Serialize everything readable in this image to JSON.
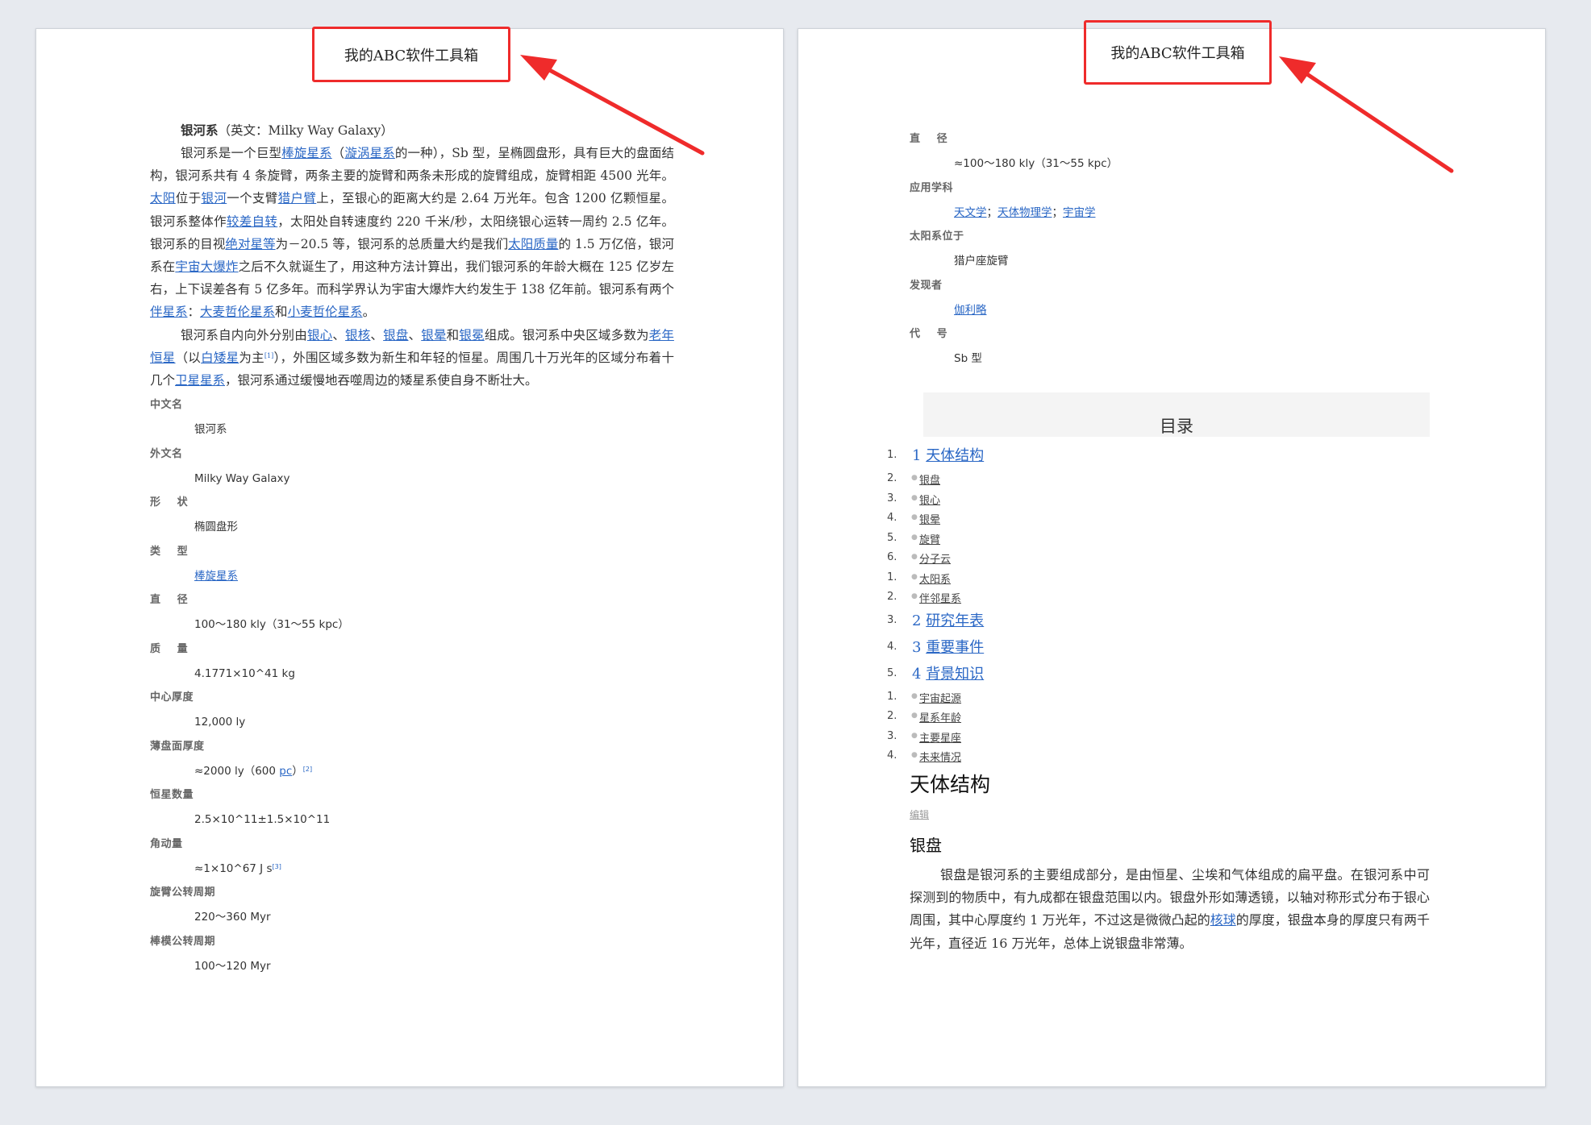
{
  "header_text": "我的ABC软件工具箱",
  "colors": {
    "annotation_red": "#ef2b2b",
    "link_blue": "#2a67c5"
  },
  "left": {
    "title_bold": "银河系",
    "title_rest": "（英文：Milky Way Galaxy）",
    "p1": [
      {
        "t": "银河系是一个巨型"
      },
      {
        "t": "棒旋星系",
        "link": true
      },
      {
        "t": "（"
      },
      {
        "t": "漩涡星系",
        "link": true
      },
      {
        "t": "的一种），Sb 型，呈椭圆盘形，具有巨大的盘面结构，银河系共有 4 条旋臂，两条主要的旋臂和两条未形成的旋臂组成，旋臂相距 4500 光年。"
      },
      {
        "t": "太阳",
        "link": true
      },
      {
        "t": "位于"
      },
      {
        "t": "银河",
        "link": true
      },
      {
        "t": "一个支臂"
      },
      {
        "t": "猎户臂",
        "link": true
      },
      {
        "t": "上，至银心的距离大约是 2.64 万光年。包含 1200 亿颗恒星。银河系整体作"
      },
      {
        "t": "较差自转",
        "link": true
      },
      {
        "t": "，太阳处自转速度约 220 千米/秒，太阳绕银心运转一周约 2.5 亿年。银河系的目视"
      },
      {
        "t": "绝对星等",
        "link": true
      },
      {
        "t": "为－20.5 等，银河系的总质量大约是我们"
      },
      {
        "t": "太阳质量",
        "link": true
      },
      {
        "t": "的 1.5 万亿倍，银河系在"
      },
      {
        "t": "宇宙大爆炸",
        "link": true
      },
      {
        "t": "之后不久就诞生了，用这种方法计算出，我们银河系的年龄大概在 125 亿岁左右，上下误差各有 5 亿多年。而科学界认为宇宙大爆炸大约发生于 138 亿年前。银河系有两个"
      },
      {
        "t": "伴星系",
        "link": true
      },
      {
        "t": "："
      },
      {
        "t": "大麦哲伦星系",
        "link": true
      },
      {
        "t": "和"
      },
      {
        "t": "小麦哲伦星系",
        "link": true
      },
      {
        "t": "。"
      }
    ],
    "p2": [
      {
        "t": "银河系自内向外分别由"
      },
      {
        "t": "银心",
        "link": true
      },
      {
        "t": "、"
      },
      {
        "t": "银核",
        "link": true
      },
      {
        "t": "、"
      },
      {
        "t": "银盘",
        "link": true
      },
      {
        "t": "、"
      },
      {
        "t": "银晕",
        "link": true
      },
      {
        "t": "和"
      },
      {
        "t": "银冕",
        "link": true
      },
      {
        "t": "组成。银河系中央区域多数为"
      },
      {
        "t": "老年恒星",
        "link": true
      },
      {
        "t": "（以"
      },
      {
        "t": "白矮星",
        "link": true
      },
      {
        "t": "为主"
      },
      {
        "t": "[1]",
        "sup": true
      },
      {
        "t": "），外围区域多数为新生和年轻的恒星。周围几十万光年的区域分布着十几个"
      },
      {
        "t": "卫星星系",
        "link": true
      },
      {
        "t": "，银河系通过缓慢地吞噬周边的矮星系使自身不断壮大。"
      }
    ],
    "infobox": [
      {
        "label": "中文名",
        "value": [
          {
            "t": "银河系"
          }
        ]
      },
      {
        "label": "外文名",
        "value": [
          {
            "t": "Milky Way Galaxy"
          }
        ]
      },
      {
        "label": "形    状",
        "value": [
          {
            "t": "椭圆盘形"
          }
        ]
      },
      {
        "label": "类    型",
        "value": [
          {
            "t": "棒旋星系",
            "link": true
          }
        ]
      },
      {
        "label": "直    径",
        "value": [
          {
            "t": "100～180 kly（31～55 kpc）"
          }
        ]
      },
      {
        "label": "质    量",
        "value": [
          {
            "t": "4.1771×10^41 kg"
          }
        ]
      },
      {
        "label": "中心厚度",
        "value": [
          {
            "t": "12,000 ly"
          }
        ]
      },
      {
        "label": "薄盘面厚度",
        "value": [
          {
            "t": "≈2000 ly（600 "
          },
          {
            "t": "pc",
            "link": true
          },
          {
            "t": "）"
          },
          {
            "t": "[2]",
            "sup": true
          }
        ]
      },
      {
        "label": "恒星数量",
        "value": [
          {
            "t": "2.5×10^11±1.5×10^11"
          }
        ]
      },
      {
        "label": "角动量",
        "value": [
          {
            "t": "≈1×10^67 J s"
          },
          {
            "t": "[3]",
            "sup": true
          }
        ]
      },
      {
        "label": "旋臂公转周期",
        "value": [
          {
            "t": "220～360 Myr"
          }
        ]
      },
      {
        "label": "棒模公转周期",
        "value": [
          {
            "t": "100～120 Myr"
          }
        ]
      }
    ]
  },
  "right": {
    "infobox": [
      {
        "label": "直    径",
        "value": [
          {
            "t": "≈100～180 kly（31～55 kpc）"
          }
        ]
      },
      {
        "label": "应用学科",
        "value": [
          {
            "t": "天文学",
            "link": true
          },
          {
            "t": "；"
          },
          {
            "t": "天体物理学",
            "link": true
          },
          {
            "t": "；"
          },
          {
            "t": "宇宙学",
            "link": true
          }
        ]
      },
      {
        "label": "太阳系位于",
        "value": [
          {
            "t": "猎户座旋臂"
          }
        ]
      },
      {
        "label": "发现者",
        "value": [
          {
            "t": "伽利略",
            "link": true
          }
        ]
      },
      {
        "label": "代    号",
        "value": [
          {
            "t": "Sb 型"
          }
        ]
      }
    ],
    "toc_title": "目录",
    "toc": [
      {
        "level": 1,
        "num": "1.",
        "prefix": "1",
        "label": "天体结构"
      },
      {
        "level": 2,
        "num": "2.",
        "label": "银盘"
      },
      {
        "level": 2,
        "num": "3.",
        "label": "银心"
      },
      {
        "level": 2,
        "num": "4.",
        "label": "银晕"
      },
      {
        "level": 2,
        "num": "5.",
        "label": "旋臂"
      },
      {
        "level": 2,
        "num": "6.",
        "label": "分子云"
      },
      {
        "level": 2,
        "num": "1.",
        "label": "太阳系"
      },
      {
        "level": 2,
        "num": "2.",
        "label": "伴邻星系"
      },
      {
        "level": 1,
        "num": "3.",
        "prefix": "2",
        "label": "研究年表"
      },
      {
        "level": 1,
        "num": "4.",
        "prefix": "3",
        "label": "重要事件"
      },
      {
        "level": 1,
        "num": "5.",
        "prefix": "4",
        "label": "背景知识"
      },
      {
        "level": 2,
        "num": "1.",
        "label": "宇宙起源"
      },
      {
        "level": 2,
        "num": "2.",
        "label": "星系年龄"
      },
      {
        "level": 2,
        "num": "3.",
        "label": "主要星座"
      },
      {
        "level": 2,
        "num": "4.",
        "label": "未来情况"
      }
    ],
    "section_h1": "天体结构",
    "section_edit": "编辑",
    "section_h2": "银盘",
    "section_para": [
      {
        "t": "银盘是银河系的主要组成部分，是由恒星、尘埃和气体组成的扁平盘。在银河系中可探测到的物质中，有九成都在银盘范围以内。银盘外形如薄透镜，以轴对称形式分布于银心周围，其中心厚度约 1 万光年，不过这是微微凸起的"
      },
      {
        "t": "核球",
        "link": true
      },
      {
        "t": "的厚度，银盘本身的厚度只有两千光年，直径近 16 万光年，总体上说银盘非常薄。"
      }
    ]
  }
}
